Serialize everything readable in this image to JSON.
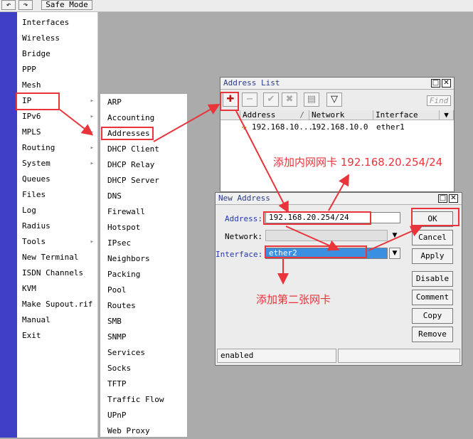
{
  "toolbar": {
    "undo_icon": "undo-icon",
    "redo_icon": "redo-icon",
    "safe_mode": "Safe Mode"
  },
  "main_menu": [
    {
      "label": "Interfaces",
      "submenu": false
    },
    {
      "label": "Wireless",
      "submenu": false
    },
    {
      "label": "Bridge",
      "submenu": false
    },
    {
      "label": "PPP",
      "submenu": false
    },
    {
      "label": "Mesh",
      "submenu": false
    },
    {
      "label": "IP",
      "submenu": true
    },
    {
      "label": "IPv6",
      "submenu": true
    },
    {
      "label": "MPLS",
      "submenu": true
    },
    {
      "label": "Routing",
      "submenu": true
    },
    {
      "label": "System",
      "submenu": true
    },
    {
      "label": "Queues",
      "submenu": false
    },
    {
      "label": "Files",
      "submenu": false
    },
    {
      "label": "Log",
      "submenu": false
    },
    {
      "label": "Radius",
      "submenu": false
    },
    {
      "label": "Tools",
      "submenu": true
    },
    {
      "label": "New Terminal",
      "submenu": false
    },
    {
      "label": "ISDN Channels",
      "submenu": false
    },
    {
      "label": "KVM",
      "submenu": false
    },
    {
      "label": "Make Supout.rif",
      "submenu": false
    },
    {
      "label": "Manual",
      "submenu": false
    },
    {
      "label": "Exit",
      "submenu": false
    }
  ],
  "ip_submenu": [
    "ARP",
    "Accounting",
    "Addresses",
    "DHCP Client",
    "DHCP Relay",
    "DHCP Server",
    "DNS",
    "Firewall",
    "Hotspot",
    "IPsec",
    "Neighbors",
    "Packing",
    "Pool",
    "Routes",
    "SMB",
    "SNMP",
    "Services",
    "Socks",
    "TFTP",
    "Traffic Flow",
    "UPnP",
    "Web Proxy"
  ],
  "address_list": {
    "title": "Address List",
    "find_label": "Find",
    "columns": [
      "Address",
      "Network",
      "Interface"
    ],
    "sort_marker": "/",
    "rows": [
      {
        "address": "192.168.10....",
        "network": "192.168.10.0",
        "interface": "ether1"
      }
    ]
  },
  "new_address": {
    "title": "New Address",
    "address_label": "Address:",
    "address_value": "192.168.20.254/24",
    "network_label": "Network:",
    "network_value": "",
    "interface_label": "Interface:",
    "interface_value": "ether2",
    "buttons": [
      "OK",
      "Cancel",
      "Apply",
      "Disable",
      "Comment",
      "Copy",
      "Remove"
    ],
    "status": "enabled"
  },
  "annotations": {
    "lan_card": "添加内网网卡 192.168.20.254/24",
    "second_card": "添加第二张网卡"
  },
  "colors": {
    "highlight": "#e8343a",
    "sidebar": "#3f3fc5",
    "selection": "#3b8fe0"
  }
}
